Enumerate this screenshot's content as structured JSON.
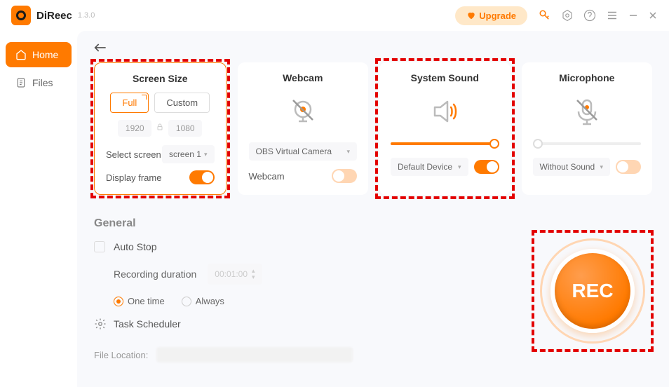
{
  "app": {
    "name": "DiReec",
    "version": "1.3.0"
  },
  "titlebar": {
    "upgrade": "Upgrade"
  },
  "sidebar": {
    "items": [
      {
        "label": "Home",
        "icon": "home-icon",
        "active": true
      },
      {
        "label": "Files",
        "icon": "files-icon",
        "active": false
      }
    ]
  },
  "cards": {
    "screen": {
      "title": "Screen Size",
      "tab_full": "Full",
      "tab_custom": "Custom",
      "width": "1920",
      "height": "1080",
      "select_label": "Select screen",
      "select_value": "screen 1",
      "display_frame_label": "Display frame",
      "display_frame_on": true
    },
    "webcam": {
      "title": "Webcam",
      "device": "OBS Virtual Camera",
      "toggle_label": "Webcam",
      "enabled": false
    },
    "system_sound": {
      "title": "System Sound",
      "device": "Default Device",
      "enabled": true
    },
    "microphone": {
      "title": "Microphone",
      "device": "Without Sound",
      "enabled": false
    }
  },
  "general": {
    "title": "General",
    "auto_stop": "Auto Stop",
    "duration_label": "Recording duration",
    "duration_value": "00:01:00",
    "one_time": "One time",
    "always": "Always",
    "task_scheduler": "Task Scheduler",
    "file_location_label": "File Location:"
  },
  "rec": {
    "label": "REC"
  }
}
